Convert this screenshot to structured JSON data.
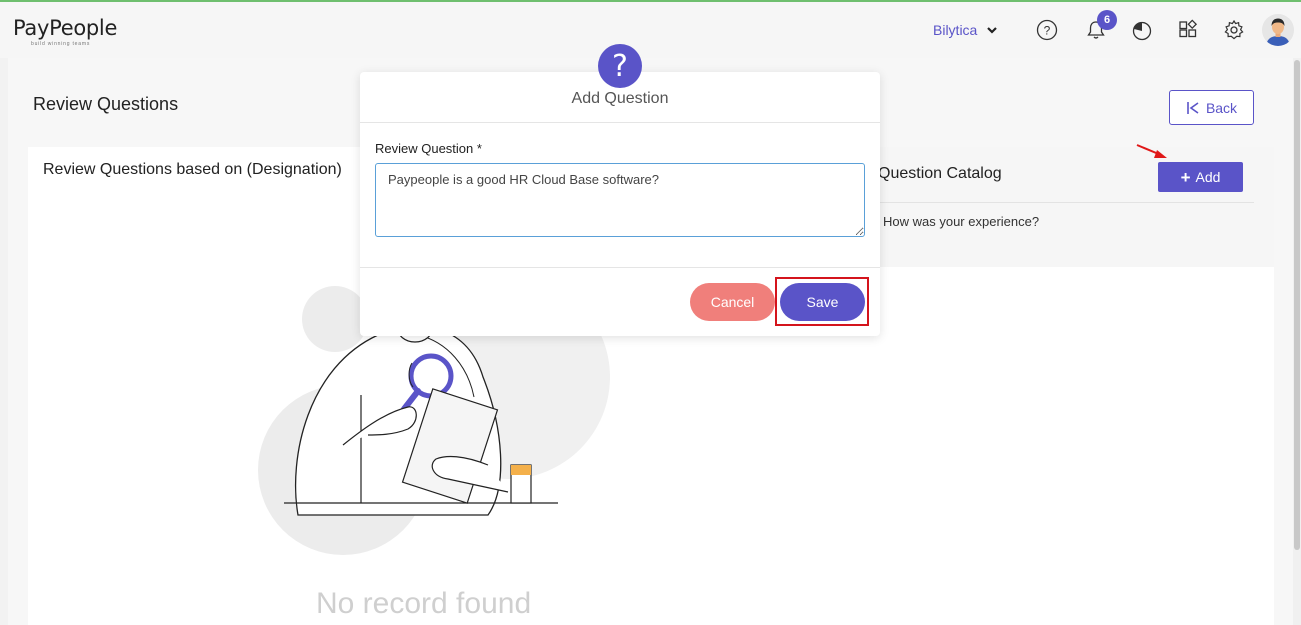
{
  "header": {
    "logo_text": "PayPeople",
    "logo_tagline": "build winning teams",
    "company_name": "Bilytica",
    "notification_count": "6",
    "icons": [
      "help-icon",
      "bell-icon",
      "pie-chart-icon",
      "apps-grid-icon",
      "settings-icon",
      "user-avatar"
    ]
  },
  "page": {
    "title": "Review Questions",
    "back_label": "Back"
  },
  "left_panel": {
    "title": "Review Questions based on (Designation)",
    "empty_text": "No record found"
  },
  "right_panel": {
    "title": "Question Catalog",
    "add_label": "Add",
    "items": [
      "How was your experience?"
    ]
  },
  "modal": {
    "title": "Add Question",
    "field_label": "Review Question *",
    "field_value": "Paypeople is a good HR Cloud Base software?",
    "cancel_label": "Cancel",
    "save_label": "Save"
  },
  "colors": {
    "brand": "#5a54c8",
    "cancel": "#f07f7b",
    "highlight": "#d4141c"
  }
}
